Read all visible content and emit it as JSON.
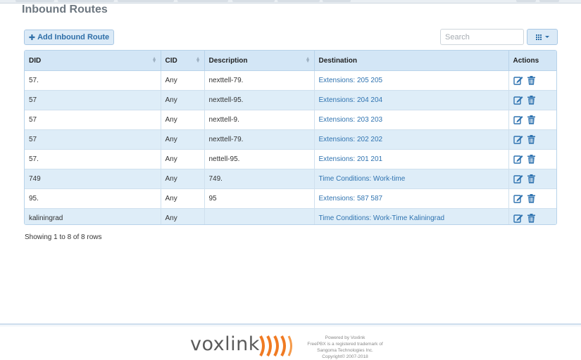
{
  "page": {
    "title": "Inbound Routes"
  },
  "toolbar": {
    "add_label": "Add Inbound Route",
    "search_placeholder": "Search",
    "columns_icon": "grid-icon"
  },
  "table": {
    "columns": [
      "DID",
      "CID",
      "Description",
      "Destination",
      "Actions"
    ],
    "rows": [
      {
        "did": "57.",
        "cid": "Any",
        "description": "nexttell-79.",
        "destination": "Extensions: 205 205"
      },
      {
        "did": "57",
        "cid": "Any",
        "description": "nexttell-95.",
        "destination": "Extensions: 204 204"
      },
      {
        "did": "57",
        "cid": "Any",
        "description": "nexttell-9.",
        "destination": "Extensions: 203 203"
      },
      {
        "did": "57",
        "cid": "Any",
        "description": "nexttell-79.",
        "destination": "Extensions: 202 202"
      },
      {
        "did": "57.",
        "cid": "Any",
        "description": "nettell-95.",
        "destination": "Extensions: 201 201"
      },
      {
        "did": "749",
        "cid": "Any",
        "description": "749.",
        "destination": "Time Conditions: Work-time"
      },
      {
        "did": "95.",
        "cid": "Any",
        "description": "95",
        "destination": "Extensions: 587 587"
      },
      {
        "did": "kaliningrad",
        "cid": "Any",
        "description": "",
        "destination": "Time Conditions: Work-Time Kaliningrad"
      }
    ],
    "action_icons": [
      "edit-icon",
      "trash-icon"
    ]
  },
  "pagination": {
    "showing": "Showing 1 to 8 of 8 rows"
  },
  "footer": {
    "logo": "voxlink",
    "powered_lines": [
      "Powered by Voxlink",
      "FreePBX is a registered trademark of",
      "Sangoma Technologies Inc.",
      "Copyright© 2007-2018"
    ]
  },
  "colors": {
    "accent": "#2f73b0",
    "header_bg": "#d3e6f6",
    "row_alt_bg": "#deedf8",
    "logo_orange": "#f07a22"
  }
}
